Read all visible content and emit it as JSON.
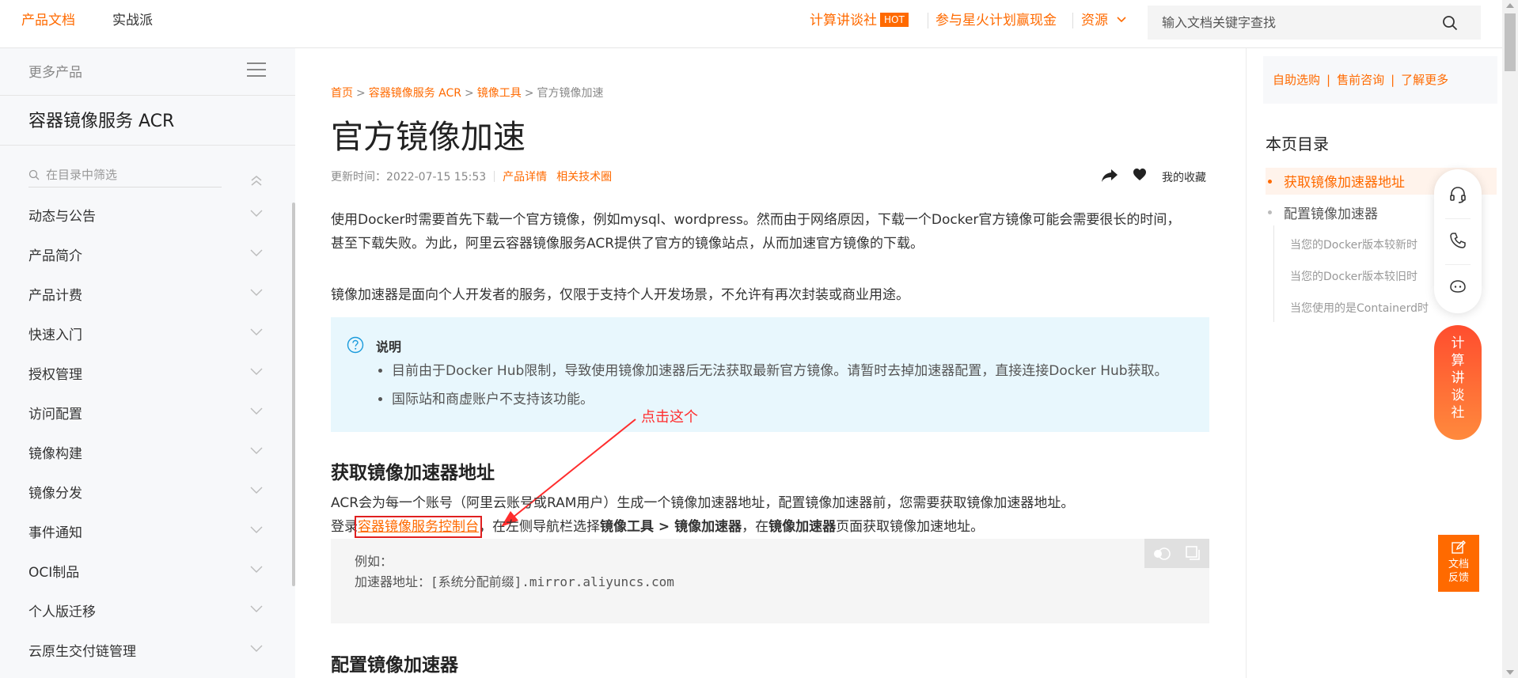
{
  "colors": {
    "accent": "#ff6a00",
    "annotation": "#ff2d2d",
    "note_bg": "#e8f7fd"
  },
  "topbar": {
    "tab_docs": "产品文档",
    "tab_practice": "实战派",
    "link_calc": "计算讲谈社",
    "hot_badge": "HOT",
    "link_spark": "参与星火计划赢现金",
    "link_resources": "资源",
    "search_placeholder": "输入文档关键字查找"
  },
  "sidebar": {
    "more_products": "更多产品",
    "product_title": "容器镜像服务 ACR",
    "filter_placeholder": "在目录中筛选",
    "items": [
      {
        "label": "动态与公告"
      },
      {
        "label": "产品简介"
      },
      {
        "label": "产品计费"
      },
      {
        "label": "快速入门"
      },
      {
        "label": "授权管理"
      },
      {
        "label": "访问配置"
      },
      {
        "label": "镜像构建"
      },
      {
        "label": "镜像分发"
      },
      {
        "label": "事件通知"
      },
      {
        "label": "OCI制品"
      },
      {
        "label": "个人版迁移"
      },
      {
        "label": "云原生交付链管理"
      }
    ]
  },
  "main": {
    "breadcrumb": {
      "home": "首页",
      "acr": "容器镜像服务 ACR",
      "tools": "镜像工具",
      "current": "官方镜像加速"
    },
    "title": "官方镜像加速",
    "updated": "更新时间：2022-07-15 15:53",
    "link_product_detail": "产品详情",
    "link_tech_circle": "相关技术圈",
    "favorites": "我的收藏",
    "para1": "使用Docker时需要首先下载一个官方镜像，例如mysql、wordpress。然而由于网络原因，下载一个Docker官方镜像可能会需要很长的时间，甚至下载失败。为此，阿里云容器镜像服务ACR提供了官方的镜像站点，从而加速官方镜像的下载。",
    "para2": "镜像加速器是面向个人开发者的服务，仅限于支持个人开发场景，不允许有再次封装或商业用途。",
    "note": {
      "title": "说明",
      "items": [
        "目前由于Docker Hub限制，导致使用镜像加速器后无法获取最新官方镜像。请暂时去掉加速器配置，直接连接Docker Hub获取。",
        "国际站和商虚账户不支持该功能。"
      ]
    },
    "annotation": "点击这个",
    "h2_get": "获取镜像加速器地址",
    "p3_line1": "ACR会为每一个账号（阿里云账号或RAM用户）生成一个镜像加速器地址，配置镜像加速器前，您需要获取镜像加速器地址。",
    "p3_pre": "登录",
    "p3_link": "容器镜像服务控制台",
    "p3_mid1": "，在左侧导航栏选择",
    "p3_bold1": "镜像工具 > 镜像加速器",
    "p3_mid2": "，在",
    "p3_bold2": "镜像加速器",
    "p3_end": "页面获取镜像加速地址。",
    "code": "例如：\n加速器地址：[系统分配前缀].mirror.aliyuncs.com",
    "h2_config": "配置镜像加速器"
  },
  "right": {
    "consult_1": "自助选购",
    "consult_2": "售前咨询",
    "consult_3": "了解更多",
    "toc_title": "本页目录",
    "toc_1": "获取镜像加速器地址",
    "toc_2": "配置镜像加速器",
    "toc_sub_1": "当您的Docker版本较新时",
    "toc_sub_2": "当您的Docker版本较旧时",
    "toc_sub_3": "当您使用的是Containerd时",
    "calc_chars": [
      "计",
      "算",
      "讲",
      "谈",
      "社"
    ],
    "feedback_1": "文档",
    "feedback_2": "反馈"
  }
}
